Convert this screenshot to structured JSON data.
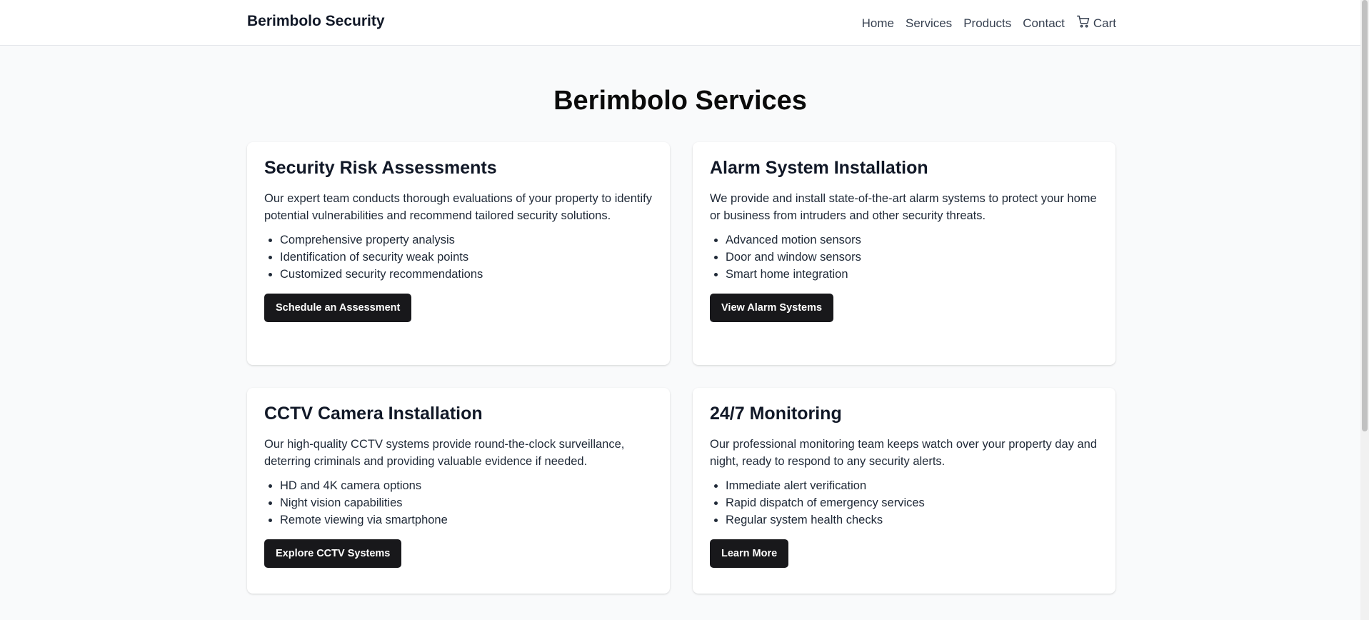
{
  "header": {
    "brand": "Berimbolo Security",
    "nav": [
      "Home",
      "Services",
      "Products",
      "Contact"
    ],
    "cart_label": "Cart"
  },
  "main": {
    "title": "Berimbolo Services",
    "cards": [
      {
        "title": "Security Risk Assessments",
        "description": "Our expert team conducts thorough evaluations of your property to identify potential vulnerabilities and recommend tailored security solutions.",
        "features": [
          "Comprehensive property analysis",
          "Identification of security weak points",
          "Customized security recommendations"
        ],
        "button": "Schedule an Assessment"
      },
      {
        "title": "Alarm System Installation",
        "description": "We provide and install state-of-the-art alarm systems to protect your home or business from intruders and other security threats.",
        "features": [
          "Advanced motion sensors",
          "Door and window sensors",
          "Smart home integration"
        ],
        "button": "View Alarm Systems"
      },
      {
        "title": "CCTV Camera Installation",
        "description": "Our high-quality CCTV systems provide round-the-clock surveillance, deterring criminals and providing valuable evidence if needed.",
        "features": [
          "HD and 4K camera options",
          "Night vision capabilities",
          "Remote viewing via smartphone"
        ],
        "button": "Explore CCTV Systems"
      },
      {
        "title": "24/7 Monitoring",
        "description": "Our professional monitoring team keeps watch over your property day and night, ready to respond to any security alerts.",
        "features": [
          "Immediate alert verification",
          "Rapid dispatch of emergency services",
          "Regular system health checks"
        ],
        "button": "Learn More"
      }
    ]
  },
  "colors": {
    "background": "#f9fafb",
    "card": "#ffffff",
    "button": "#18181b",
    "button_text": "#ffffff",
    "text": "#111827"
  }
}
